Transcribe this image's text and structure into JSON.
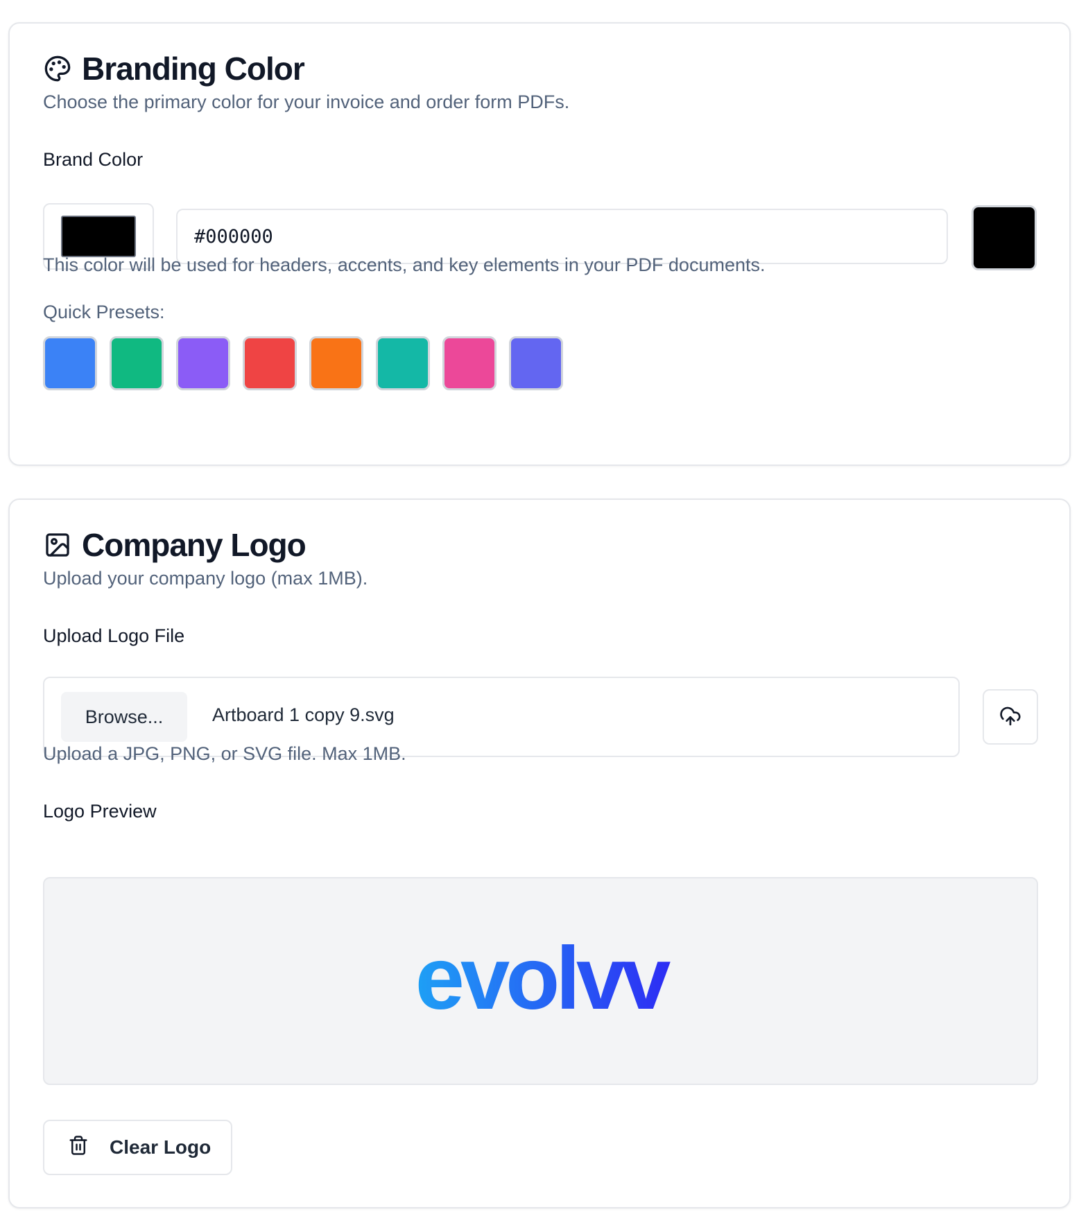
{
  "branding": {
    "title": "Branding Color",
    "title_icon": "palette-icon",
    "description": "Choose the primary color for your invoice and order form PDFs.",
    "field_label": "Brand Color",
    "color_value": "#000000",
    "help_text": "This color will be used for headers, accents, and key elements in your PDF documents.",
    "presets_label": "Quick Presets:",
    "presets": [
      "#3b82f6",
      "#10b981",
      "#8b5cf6",
      "#ef4444",
      "#f97316",
      "#14b8a6",
      "#ec4899",
      "#6366f1"
    ]
  },
  "logo": {
    "title": "Company Logo",
    "title_icon": "image-icon",
    "description": "Upload your company logo (max 1MB).",
    "upload_label": "Upload Logo File",
    "browse_label": "Browse...",
    "file_name": "Artboard 1 copy 9.svg",
    "upload_icon": "cloud-upload-icon",
    "help_text": "Upload a JPG, PNG, or SVG file. Max 1MB.",
    "preview_label": "Logo Preview",
    "preview_logo_text": "evolvv",
    "logo_gradient": [
      "#1ea0f5",
      "#2d2cf4"
    ],
    "clear_label": "Clear Logo",
    "clear_icon": "trash-icon"
  }
}
